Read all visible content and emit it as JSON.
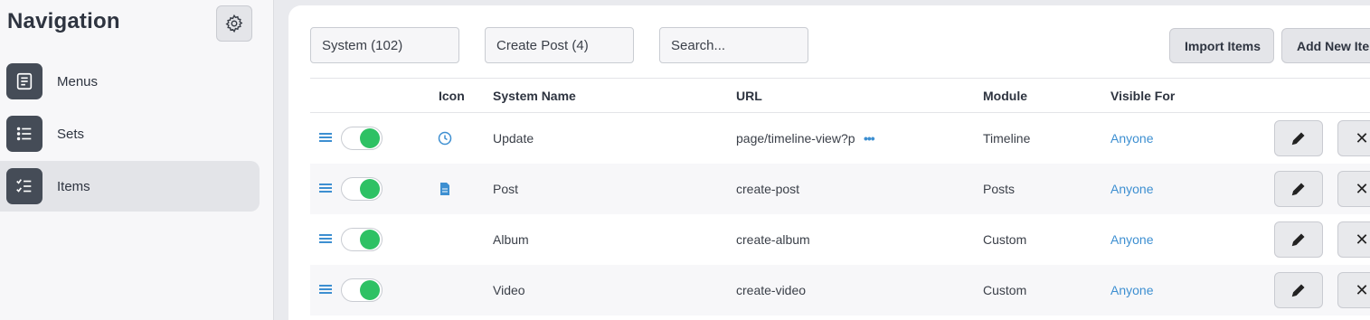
{
  "sidebar": {
    "title": "Navigation",
    "settings_icon": "gear-icon",
    "items": [
      {
        "label": "Menus",
        "icon": "document-icon",
        "active": false
      },
      {
        "label": "Sets",
        "icon": "list-icon",
        "active": false
      },
      {
        "label": "Items",
        "icon": "checklist-icon",
        "active": true
      }
    ]
  },
  "toolbar": {
    "filter_system": "System (102)",
    "filter_create_post": "Create Post (4)",
    "search_placeholder": "Search...",
    "import_label": "Import Items",
    "add_label": "Add New Item"
  },
  "table": {
    "headers": {
      "icon": "Icon",
      "system_name": "System Name",
      "url": "URL",
      "module": "Module",
      "visible_for": "Visible For"
    },
    "rows": [
      {
        "enabled": true,
        "icon": "clock-icon",
        "system_name": "Update",
        "url": "page/timeline-view?p",
        "url_truncated": true,
        "module": "Timeline",
        "visible_for": "Anyone"
      },
      {
        "enabled": true,
        "icon": "file-icon",
        "system_name": "Post",
        "url": "create-post",
        "url_truncated": false,
        "module": "Posts",
        "visible_for": "Anyone"
      },
      {
        "enabled": true,
        "icon": "",
        "system_name": "Album",
        "url": "create-album",
        "url_truncated": false,
        "module": "Custom",
        "visible_for": "Anyone"
      },
      {
        "enabled": true,
        "icon": "",
        "system_name": "Video",
        "url": "create-video",
        "url_truncated": false,
        "module": "Custom",
        "visible_for": "Anyone"
      }
    ],
    "more_indicator": "•••",
    "edit_icon": "pencil-icon",
    "delete_icon": "close-icon",
    "delete_glyph": "✕"
  },
  "colors": {
    "accent": "#3d8fd1",
    "toggle_on": "#2ec164",
    "nav_icon_bg": "#454c57"
  }
}
